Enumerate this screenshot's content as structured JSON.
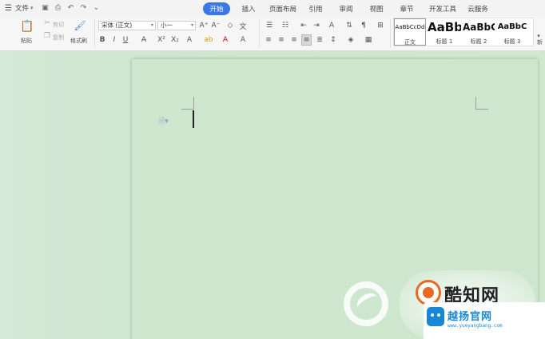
{
  "menu": {
    "file_label": "文件",
    "tabs": [
      {
        "label": "开始",
        "active": true
      },
      {
        "label": "插入",
        "active": false
      },
      {
        "label": "页面布局",
        "active": false
      },
      {
        "label": "引用",
        "active": false
      },
      {
        "label": "审阅",
        "active": false
      },
      {
        "label": "视图",
        "active": false
      },
      {
        "label": "章节",
        "active": false
      },
      {
        "label": "开发工具",
        "active": false
      },
      {
        "label": "云服务",
        "active": false
      }
    ]
  },
  "ribbon": {
    "paste_label": "粘贴",
    "cut_label": "剪切",
    "copy_label": "复制",
    "format_painter_label": "格式刷",
    "font_name": "宋体 (正文)",
    "font_size": "小一",
    "styles": [
      {
        "sample": "AaBbCcDd",
        "name": "正文"
      },
      {
        "sample": "AaBb",
        "name": "标题 1"
      },
      {
        "sample": "AaBbC",
        "name": "标题 2"
      },
      {
        "sample": "AaBbC",
        "name": "标题 3"
      }
    ],
    "new_style_label": "新"
  },
  "watermark": {
    "brand_top": "酷知网",
    "brand_bottom": "越扬官网",
    "url": "www.yueyangbang.com"
  },
  "colors": {
    "active_tab": "#3b78e7",
    "page_bg": "#cde6cd",
    "brand_orange": "#e86a1f",
    "brand_blue": "#1a87d6"
  }
}
